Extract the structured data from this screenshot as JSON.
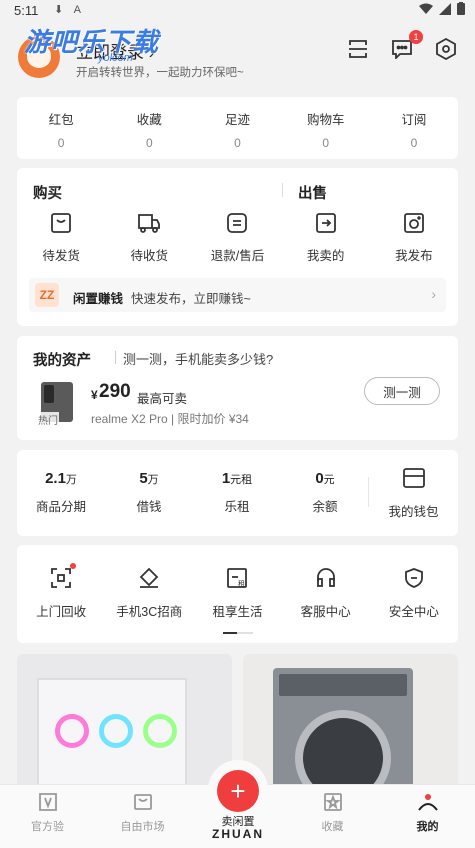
{
  "status_bar": {
    "time": "5:11",
    "notif_icons": "⬇ A"
  },
  "watermark": {
    "text": "游吧乐下载",
    "sub": "yolcom"
  },
  "header": {
    "login": "立即登录 ›",
    "tagline": "开启转转世界，一起助力环保吧~",
    "message_badge": "1",
    "icons": [
      "scan-icon",
      "message-icon",
      "settings-icon"
    ]
  },
  "stats": [
    {
      "label": "红包",
      "value": "0"
    },
    {
      "label": "收藏",
      "value": "0"
    },
    {
      "label": "足迹",
      "value": "0"
    },
    {
      "label": "购物车",
      "value": "0"
    },
    {
      "label": "订阅",
      "value": "0"
    }
  ],
  "orders": {
    "buy_title": "购买",
    "sell_title": "出售",
    "items": [
      {
        "label": "待发货",
        "icon": "box-icon"
      },
      {
        "label": "待收货",
        "icon": "truck-icon"
      },
      {
        "label": "退款/售后",
        "icon": "refund-icon"
      },
      {
        "label": "我卖的",
        "icon": "sold-icon"
      },
      {
        "label": "我发布",
        "icon": "camera-icon"
      }
    ],
    "promo": {
      "badge": "ZZ",
      "title": "闲置赚钱",
      "text": "快速发布，立即赚钱~"
    }
  },
  "assets": {
    "title": "我的资产",
    "subtitle": "测一测，手机能卖多少钱?",
    "hot_tag": "热门",
    "currency": "¥",
    "price": "290",
    "price_label": "最高可卖",
    "model": "realme X2 Pro | 限时加价 ¥34",
    "button": "测一测"
  },
  "wallet": {
    "items": [
      {
        "value": "2.1",
        "unit": "万",
        "label": "商品分期"
      },
      {
        "value": "5",
        "unit": "万",
        "label": "借钱"
      },
      {
        "value": "1",
        "unit": "元租",
        "label": "乐租"
      },
      {
        "value": "0",
        "unit": "元",
        "label": "余额"
      }
    ],
    "purse_label": "我的钱包"
  },
  "services": [
    {
      "label": "上门回收",
      "icon": "recycle-icon"
    },
    {
      "label": "手机3C招商",
      "icon": "diamond-icon"
    },
    {
      "label": "租享生活",
      "icon": "rent-icon"
    },
    {
      "label": "客服中心",
      "icon": "headset-icon"
    },
    {
      "label": "安全中心",
      "icon": "shield-icon"
    }
  ],
  "tabbar": {
    "tabs": [
      {
        "label": "官方验",
        "icon": "verify-icon"
      },
      {
        "label": "自由市场",
        "icon": "market-icon"
      },
      {
        "label": "卖闲置",
        "icon": "plus-icon"
      },
      {
        "label": "收藏",
        "icon": "star-icon"
      },
      {
        "label": "我的",
        "icon": "profile-icon"
      }
    ],
    "sell_symbol": "+",
    "brand": "ZHUAN"
  }
}
